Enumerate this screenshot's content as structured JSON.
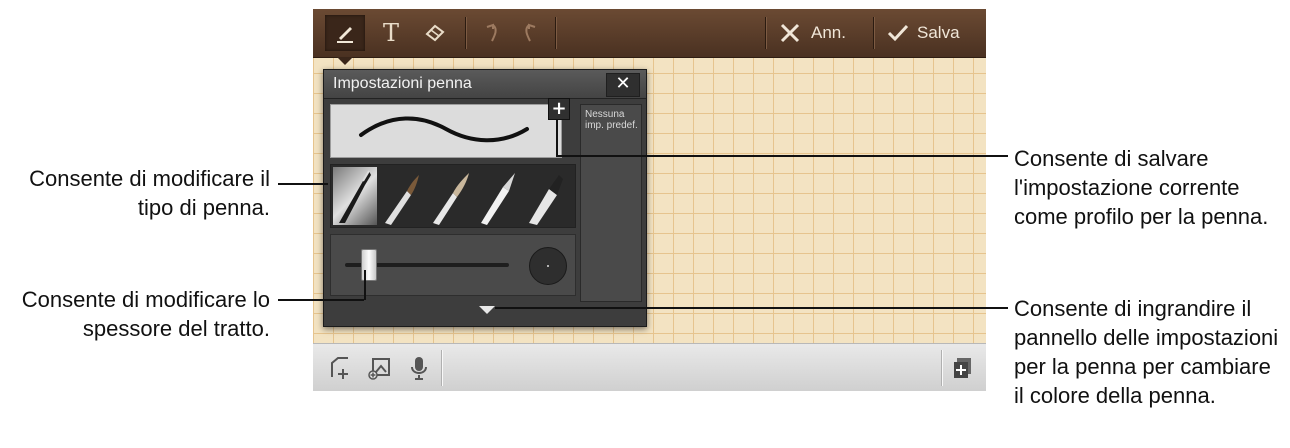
{
  "toolbar": {
    "pen_icon": "pen-icon",
    "text_icon_glyph": "T",
    "eraser_icon": "eraser-icon",
    "undo_icon": "undo-icon",
    "redo_icon": "redo-icon",
    "cancel_label": "Ann.",
    "save_label": "Salva"
  },
  "pen_settings": {
    "title": "Impostazioni penna",
    "close_glyph": "✕",
    "add_glyph": "+",
    "preset_text": "Nessuna imp. predef.",
    "expand_icon": "triangle-down-icon"
  },
  "bottom_toolbar": {
    "icons": [
      "new-page-icon",
      "insert-image-icon",
      "microphone-icon",
      "add-page-icon"
    ]
  },
  "callouts": {
    "pen_type": "Consente di modificare il tipo di penna.",
    "thickness": "Consente di modificare lo spessore del tratto.",
    "save_preset": "Consente di salvare l'impostazione corrente come profilo per la penna.",
    "expand_panel": "Consente di ingrandire il pannello delle impostazioni per la penna per cambiare il colore della penna."
  },
  "colors": {
    "toolbar_brown": "#5a3d2a",
    "paper": "#f3e3c2",
    "grid": "#e6c48e",
    "panel": "#3d3d3d"
  }
}
